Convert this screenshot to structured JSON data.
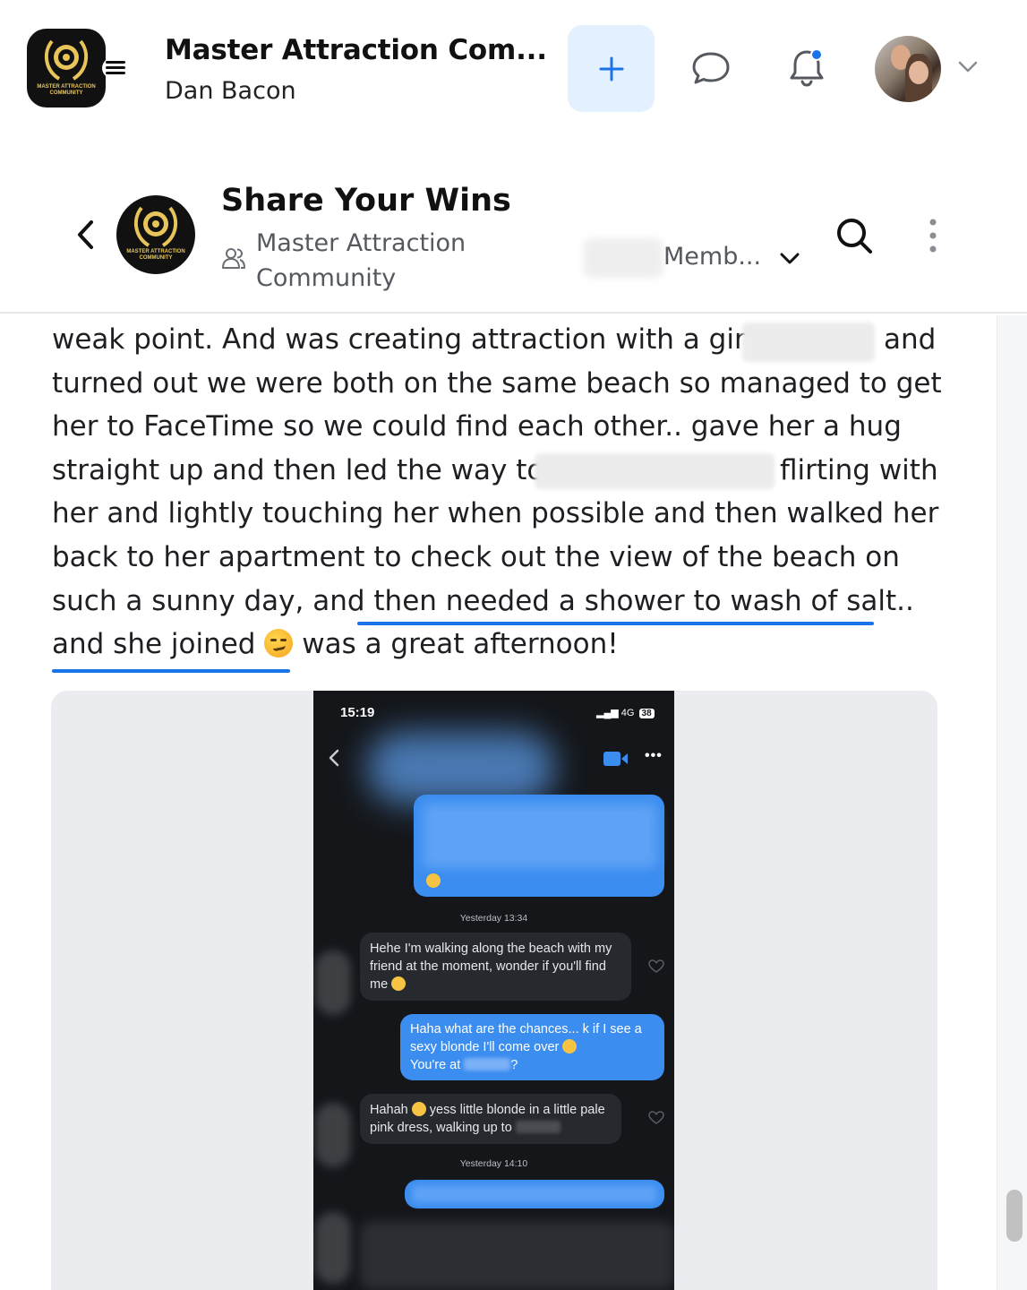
{
  "header": {
    "app_title": "Master Attraction Com...",
    "user_name": "Dan Bacon",
    "logo_text": "MASTER ATTRACTION COMMUNITY"
  },
  "group": {
    "title": "Share Your Wins",
    "community_line1": "Master Attraction",
    "community_line2": "Community",
    "members_label": "Memb..."
  },
  "post": {
    "lines": [
      "weak point. And was creating attraction with a girl",
      "and",
      "turned out we were both on the same beach so managed to get",
      "her to FaceTime so we could find each other.. gave her a hug",
      "straight up and then led the way to",
      "flirting with",
      "her and lightly touching her when possible and then walked her",
      "back to her apartment to check out the view of the beach on",
      "such a sunny day, and then needed a shower to wash of salt..",
      "and she joined",
      "was a great afternoon!"
    ]
  },
  "screenshot": {
    "time": "15:19",
    "network": "4G",
    "battery": "38",
    "stamp1": "Yesterday 13:34",
    "msg1": "Hehe I'm walking along the beach with my friend at the moment, wonder if you'll find me",
    "msg2_a": "Haha what are the chances... k if I see a sexy blonde I'll come over",
    "msg2_b": "You're at",
    "msg3_a": "Hahah",
    "msg3_b": "yess little blonde in a little pale pink dress, walking up to",
    "stamp2": "Yesterday 14:10"
  },
  "colors": {
    "accent": "#1a73e8",
    "create_bg": "#e3f0fd",
    "bubble_blue": "#3b8df0"
  }
}
